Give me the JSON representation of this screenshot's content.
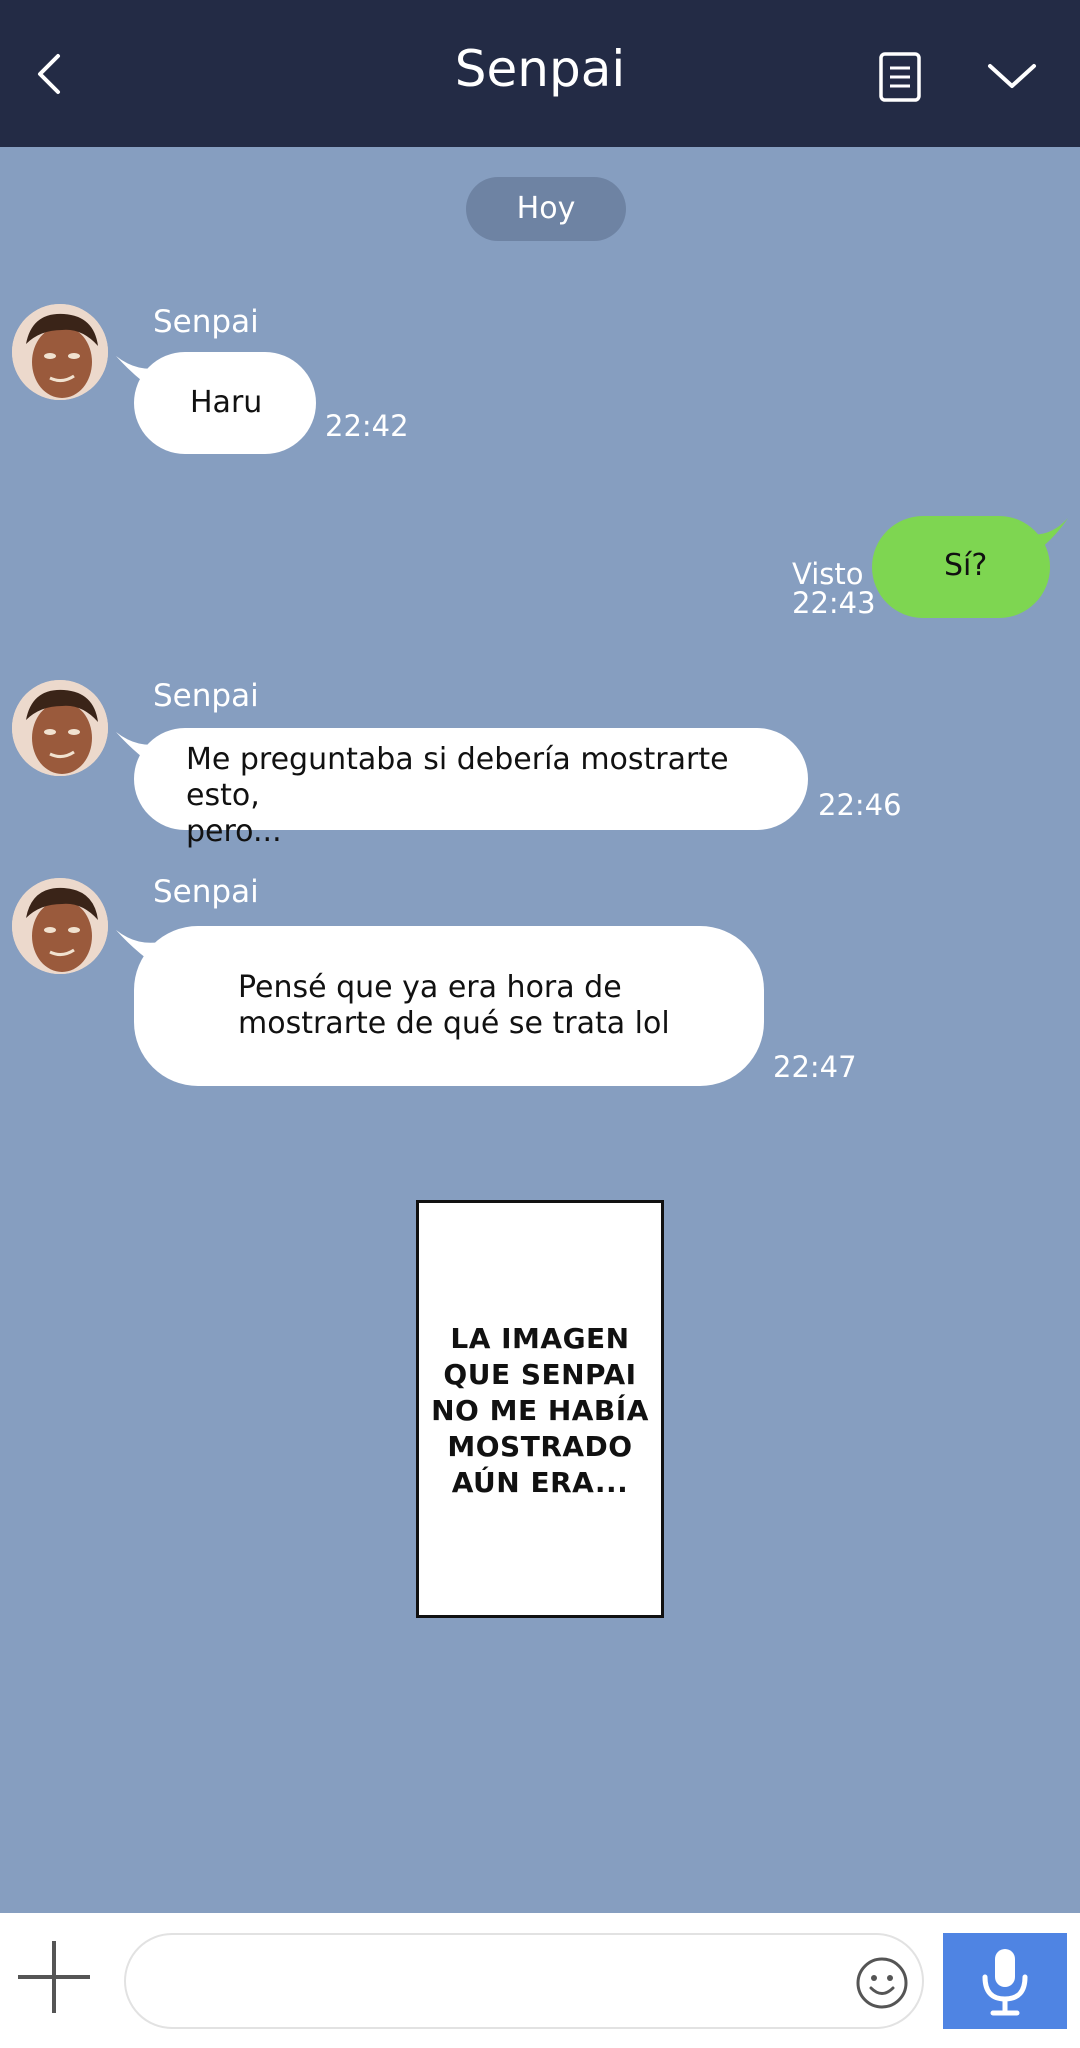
{
  "header": {
    "title": "Senpai"
  },
  "date_separator": "Hoy",
  "messages": [
    {
      "sender": "Senpai",
      "text": "Haru",
      "time": "22:42"
    },
    {
      "status": "Visto",
      "text": "Sí?",
      "time": "22:43"
    },
    {
      "sender": "Senpai",
      "text": "Me preguntaba si debería mostrarte esto,\npero...",
      "time": "22:46"
    },
    {
      "sender": "Senpai",
      "text": "Pensé que ya era hora de\nmostrarte de qué se trata lol",
      "time": "22:47"
    }
  ],
  "image_card": {
    "text": "LA IMAGEN\nQUE SENPAI\nNO ME HABÍA\nMOSTRADO\nAÚN ERA..."
  },
  "composer": {
    "placeholder": ""
  },
  "colors": {
    "header_bg": "#232b45",
    "chat_bg": "#869ec0",
    "incoming_bubble": "#ffffff",
    "outgoing_bubble": "#7ed651",
    "mic_button": "#4f84e3"
  },
  "icons": {
    "back": "chevron-left-icon",
    "notes": "notes-icon",
    "menu": "chevron-down-icon",
    "plus": "plus-icon",
    "emoji": "smiley-icon",
    "mic": "microphone-icon"
  }
}
